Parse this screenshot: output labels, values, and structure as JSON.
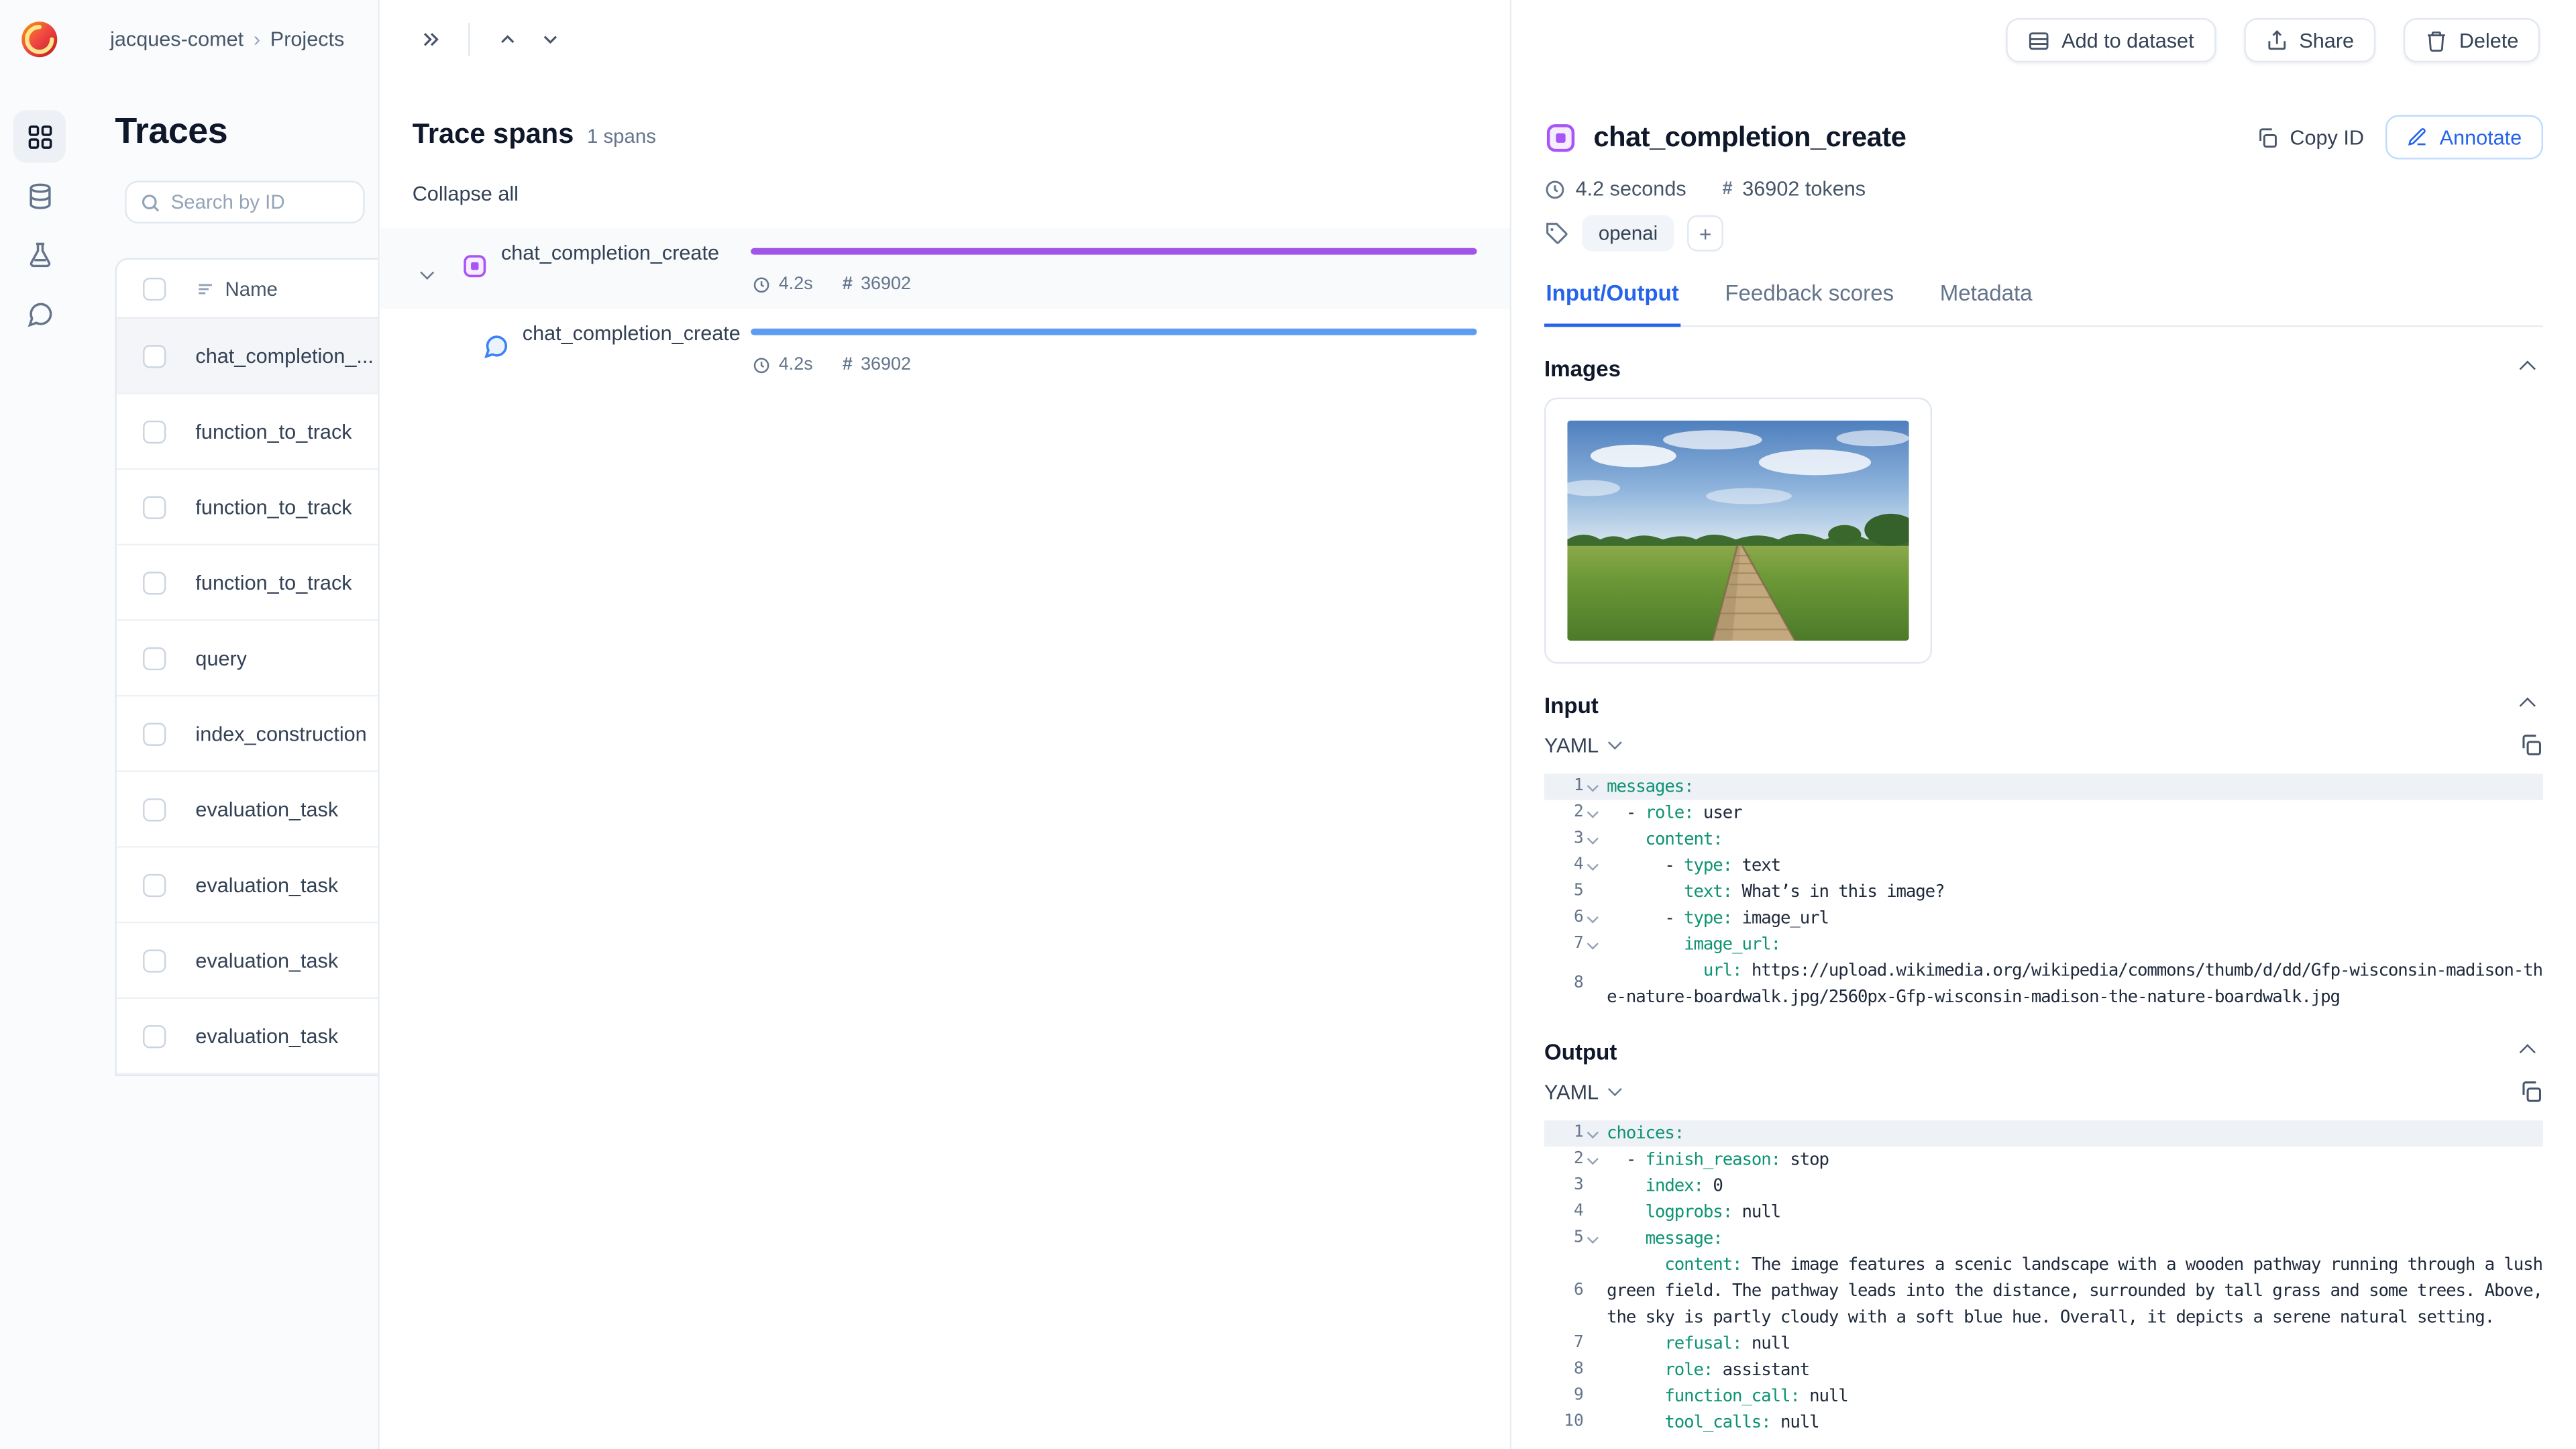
{
  "colors": {
    "accent": "#2563EB",
    "purple_bar": "#A055E8",
    "blue_bar": "#5C9DF2",
    "yaml_key": "#0E9373"
  },
  "icons": {
    "hash": "#"
  },
  "breadcrumb": {
    "workspace": "jacques-comet",
    "separator": "›",
    "section": "Projects"
  },
  "actions": {
    "add_to_dataset": "Add to dataset",
    "share": "Share",
    "delete": "Delete"
  },
  "traces": {
    "title": "Traces",
    "search_placeholder": "Search by ID",
    "name_column": "Name",
    "rows": [
      "chat_completion_...",
      "function_to_track",
      "function_to_track",
      "function_to_track",
      "query",
      "index_construction",
      "evaluation_task",
      "evaluation_task",
      "evaluation_task",
      "evaluation_task"
    ]
  },
  "spans": {
    "title": "Trace spans",
    "count": "1 spans",
    "collapse_all": "Collapse all",
    "items": [
      {
        "name": "chat_completion_create",
        "duration": "4.2s",
        "tokens": "36902"
      },
      {
        "name": "chat_completion_create",
        "duration": "4.2s",
        "tokens": "36902"
      }
    ]
  },
  "detail": {
    "title": "chat_completion_create",
    "copy_id": "Copy ID",
    "annotate": "Annotate",
    "duration": "4.2 seconds",
    "tokens": "36902 tokens",
    "tag": "openai",
    "add_tag": "+",
    "tabs": [
      "Input/Output",
      "Feedback scores",
      "Metadata"
    ],
    "active_tab": "Input/Output",
    "sections": {
      "images": "Images",
      "input": "Input",
      "output": "Output"
    },
    "format_select": "YAML",
    "input_code": [
      {
        "n": 1,
        "chev": true,
        "indent": 0,
        "dash": false,
        "key": "messages",
        "value": ""
      },
      {
        "n": 2,
        "chev": true,
        "indent": 1,
        "dash": true,
        "key": "role",
        "value": "user"
      },
      {
        "n": 3,
        "chev": true,
        "indent": 2,
        "dash": false,
        "key": "content",
        "value": ""
      },
      {
        "n": 4,
        "chev": true,
        "indent": 3,
        "dash": true,
        "key": "type",
        "value": "text"
      },
      {
        "n": 5,
        "chev": false,
        "indent": 4,
        "dash": false,
        "key": "text",
        "value": "What’s in this image?"
      },
      {
        "n": 6,
        "chev": true,
        "indent": 3,
        "dash": true,
        "key": "type",
        "value": "image_url"
      },
      {
        "n": 7,
        "chev": true,
        "indent": 4,
        "dash": false,
        "key": "image_url",
        "value": ""
      },
      {
        "n": 8,
        "chev": false,
        "indent": 5,
        "dash": false,
        "key": "url",
        "value": "https://upload.wikimedia.org/wikipedia/commons/thumb/d/dd/Gfp-wisconsin-madison-the-nature-boardwalk.jpg/2560px-Gfp-wisconsin-madison-the-nature-boardwalk.jpg"
      }
    ],
    "output_code": [
      {
        "n": 1,
        "chev": true,
        "indent": 0,
        "dash": false,
        "key": "choices",
        "value": ""
      },
      {
        "n": 2,
        "chev": true,
        "indent": 1,
        "dash": true,
        "key": "finish_reason",
        "value": "stop"
      },
      {
        "n": 3,
        "chev": false,
        "indent": 2,
        "dash": false,
        "key": "index",
        "value": "0"
      },
      {
        "n": 4,
        "chev": false,
        "indent": 2,
        "dash": false,
        "key": "logprobs",
        "value": "null"
      },
      {
        "n": 5,
        "chev": true,
        "indent": 2,
        "dash": false,
        "key": "message",
        "value": ""
      },
      {
        "n": 6,
        "chev": false,
        "indent": 3,
        "dash": false,
        "key": "content",
        "value": "The image features a scenic landscape with a wooden pathway running through a lush green field. The pathway leads into the distance, surrounded by tall grass and some trees. Above, the sky is partly cloudy with a soft blue hue. Overall, it depicts a serene natural setting."
      },
      {
        "n": 7,
        "chev": false,
        "indent": 3,
        "dash": false,
        "key": "refusal",
        "value": "null"
      },
      {
        "n": 8,
        "chev": false,
        "indent": 3,
        "dash": false,
        "key": "role",
        "value": "assistant"
      },
      {
        "n": 9,
        "chev": false,
        "indent": 3,
        "dash": false,
        "key": "function_call",
        "value": "null"
      },
      {
        "n": 10,
        "chev": false,
        "indent": 3,
        "dash": false,
        "key": "tool_calls",
        "value": "null"
      }
    ]
  }
}
